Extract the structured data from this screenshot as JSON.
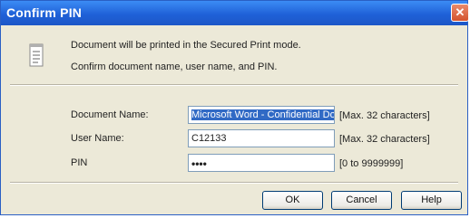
{
  "window": {
    "title": "Confirm PIN",
    "close_glyph": "✕"
  },
  "message": {
    "icon": "document-icon",
    "line1": "Document will be printed in the Secured Print mode.",
    "line2": "Confirm document name, user name, and PIN."
  },
  "form": {
    "document_name": {
      "label": "Document Name:",
      "value": "Microsoft Word - Confidential Do",
      "hint": "[Max. 32 characters]"
    },
    "user_name": {
      "label": "User Name:",
      "value": "C12133",
      "hint": "[Max. 32 characters]"
    },
    "pin": {
      "label": "PIN",
      "value": "••••",
      "hint": "[0 to 9999999]"
    }
  },
  "buttons": {
    "ok": "OK",
    "cancel": "Cancel",
    "help": "Help"
  },
  "colors": {
    "titlebar": "#1f61d8",
    "dialog_bg": "#ece9d8",
    "selection": "#316ac5",
    "close_button": "#d4532d"
  }
}
